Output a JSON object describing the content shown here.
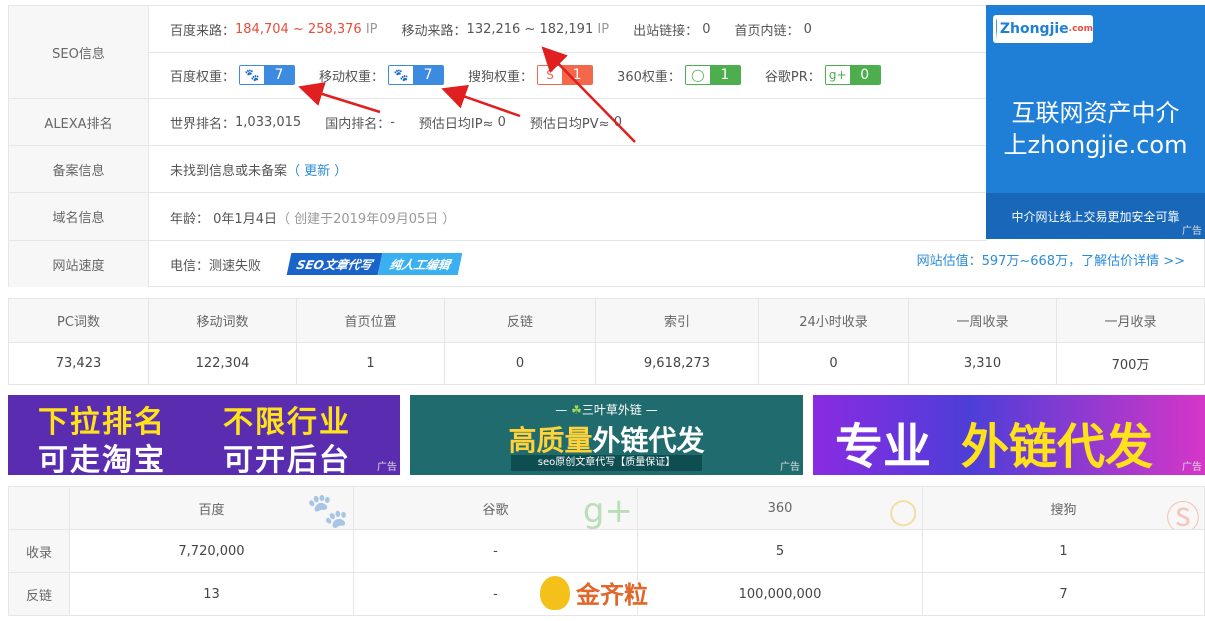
{
  "info": {
    "seo_label": "SEO信息",
    "baidu_source_label": "百度来路：",
    "baidu_source_value": "184,704 ~ 258,376",
    "baidu_source_unit": "IP",
    "mobile_source_label": "移动来路：",
    "mobile_source_value": "132,216 ~ 182,191",
    "mobile_source_unit": "IP",
    "outlinks_label": "出站链接：",
    "outlinks_value": "0",
    "homepage_inlinks_label": "首页内链：",
    "homepage_inlinks_value": "0",
    "baidu_weight_label": "百度权重：",
    "baidu_weight_value": "7",
    "mobile_weight_label": "移动权重：",
    "mobile_weight_value": "7",
    "sogou_weight_label": "搜狗权重：",
    "sogou_weight_value": "1",
    "w360_weight_label": "360权重：",
    "w360_weight_value": "1",
    "google_pr_label": "谷歌PR：",
    "google_pr_value": "0",
    "alexa_label": "ALEXA排名",
    "world_rank_label": "世界排名：",
    "world_rank_value": "1,033,015",
    "domestic_rank_label": "国内排名：",
    "domestic_rank_value": "-",
    "est_ip_label": "预估日均IP≈",
    "est_ip_value": "0",
    "est_pv_label": "预估日均PV≈",
    "est_pv_value": "0",
    "record_label": "备案信息",
    "record_text": "未找到信息或未备案",
    "record_update": "（ 更新 ）",
    "domain_label": "域名信息",
    "age_label": "年龄：",
    "age_value": "0年1月4日",
    "created_text": "（ 创建于2019年09月05日 ）",
    "speed_label": "网站速度",
    "speed_text": "电信：测速失败",
    "seo_tag_a": "SEO文章代写",
    "seo_tag_b": "纯人工编辑",
    "estimate_text": "网站估值：597万~668万，了解估价详情 >>"
  },
  "ad_zhongjie": {
    "logo_text": "Zhongjie",
    "logo_suffix": ".com",
    "title_line1": "互联网资产中介",
    "title_line2": "上zhongjie.com",
    "bar_text": "中介网让线上交易更加安全可靠",
    "ad_mark": "广告"
  },
  "stats": {
    "headers": [
      "PC词数",
      "移动词数",
      "首页位置",
      "反链",
      "索引",
      "24小时收录",
      "一周收录",
      "一月收录"
    ],
    "values": [
      "73,423",
      "122,304",
      "1",
      "0",
      "9,618,273",
      "0",
      "3,310",
      "700万"
    ]
  },
  "banners": {
    "b1_line1a": "下拉排名",
    "b1_line1b": "不限行业",
    "b1_line2a": "可走淘宝",
    "b1_line2b": "可开后台",
    "b2_top": "三叶草外链",
    "b2_main_a": "高质量",
    "b2_main_b": "外链代发",
    "b2_sub": "seo原创文章代写【质量保证】",
    "b3_a": "专业",
    "b3_b": "外链代发",
    "ad_mark": "广告"
  },
  "engines": {
    "headers": [
      "百度",
      "谷歌",
      "360",
      "搜狗"
    ],
    "rows": [
      {
        "label": "收录",
        "values": [
          "7,720,000",
          "-",
          "5",
          "1"
        ]
      },
      {
        "label": "反链",
        "values": [
          "13",
          "-",
          "100,000,000",
          "7"
        ]
      }
    ]
  },
  "watermark": {
    "text": "金齐粒"
  },
  "colors": {
    "accent_blue": "#2b8bd8",
    "red": "#e84c3d",
    "arrow_red": "#e02020"
  }
}
